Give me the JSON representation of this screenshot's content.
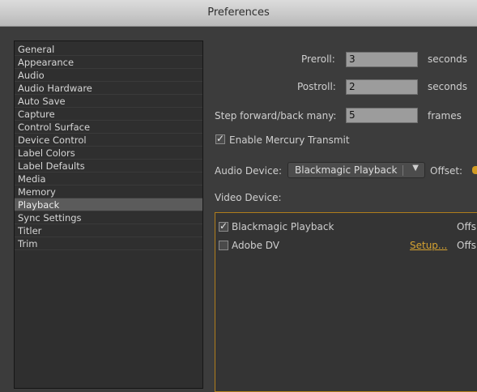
{
  "window": {
    "title": "Preferences"
  },
  "sidebar": {
    "items": [
      {
        "label": "General",
        "selected": false
      },
      {
        "label": "Appearance",
        "selected": false
      },
      {
        "label": "Audio",
        "selected": false
      },
      {
        "label": "Audio Hardware",
        "selected": false
      },
      {
        "label": "Auto Save",
        "selected": false
      },
      {
        "label": "Capture",
        "selected": false
      },
      {
        "label": "Control Surface",
        "selected": false
      },
      {
        "label": "Device Control",
        "selected": false
      },
      {
        "label": "Label Colors",
        "selected": false
      },
      {
        "label": "Label Defaults",
        "selected": false
      },
      {
        "label": "Media",
        "selected": false
      },
      {
        "label": "Memory",
        "selected": false
      },
      {
        "label": "Playback",
        "selected": true
      },
      {
        "label": "Sync Settings",
        "selected": false
      },
      {
        "label": "Titler",
        "selected": false
      },
      {
        "label": "Trim",
        "selected": false
      }
    ]
  },
  "playback": {
    "preroll": {
      "label": "Preroll:",
      "value": "3",
      "unit": "seconds"
    },
    "postroll": {
      "label": "Postroll:",
      "value": "2",
      "unit": "seconds"
    },
    "step": {
      "label": "Step forward/back many:",
      "value": "5",
      "unit": "frames"
    },
    "mercury": {
      "label": "Enable Mercury Transmit",
      "checked": true
    },
    "audio_device": {
      "label": "Audio Device:",
      "value": "Blackmagic Playback",
      "offset_label": "Offset:"
    },
    "video_device": {
      "label": "Video Device:"
    },
    "devices": [
      {
        "name": "Blackmagic Playback",
        "checked": true,
        "setup": "",
        "offset": "Offs"
      },
      {
        "name": "Adobe DV",
        "checked": false,
        "setup": "Setup...",
        "offset": "Offs"
      }
    ]
  },
  "colors": {
    "accent": "#d6a331",
    "selected": "#5b5b5b"
  }
}
